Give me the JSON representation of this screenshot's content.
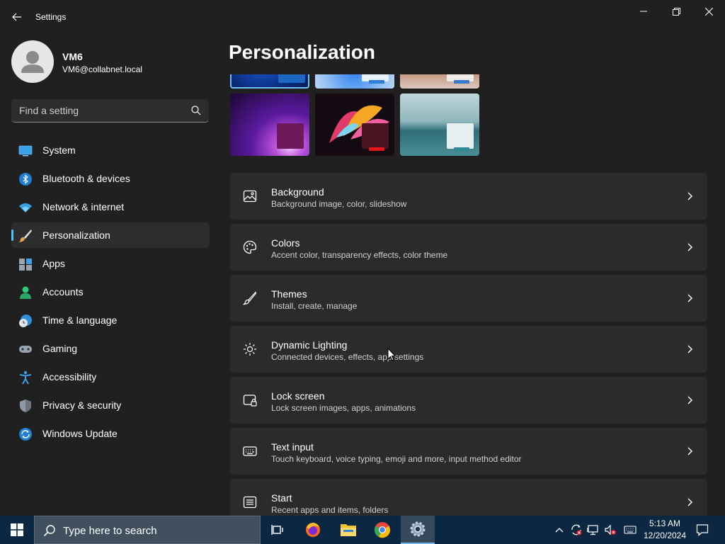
{
  "window": {
    "title": "Settings",
    "back_icon": "back-arrow-icon",
    "controls": [
      "minimize-icon",
      "maximize-icon",
      "close-icon"
    ]
  },
  "profile": {
    "name": "VM6",
    "email": "VM6@collabnet.local"
  },
  "search": {
    "placeholder": "Find a setting",
    "icon": "search-icon"
  },
  "sidebar": {
    "items": [
      {
        "label": "System",
        "icon": "system-icon",
        "active": false
      },
      {
        "label": "Bluetooth & devices",
        "icon": "bluetooth-icon",
        "active": false
      },
      {
        "label": "Network & internet",
        "icon": "wifi-icon",
        "active": false
      },
      {
        "label": "Personalization",
        "icon": "brush-icon",
        "active": true
      },
      {
        "label": "Apps",
        "icon": "apps-icon",
        "active": false
      },
      {
        "label": "Accounts",
        "icon": "accounts-icon",
        "active": false
      },
      {
        "label": "Time & language",
        "icon": "time-language-icon",
        "active": false
      },
      {
        "label": "Gaming",
        "icon": "gamepad-icon",
        "active": false
      },
      {
        "label": "Accessibility",
        "icon": "accessibility-icon",
        "active": false
      },
      {
        "label": "Privacy & security",
        "icon": "shield-icon",
        "active": false
      },
      {
        "label": "Windows Update",
        "icon": "update-icon",
        "active": false
      }
    ]
  },
  "main": {
    "title": "Personalization",
    "themes": [
      {
        "name": "theme-windows-light-blue",
        "selected": true
      },
      {
        "name": "theme-windows-bloom-light",
        "selected": false
      },
      {
        "name": "theme-desert",
        "selected": false
      },
      {
        "name": "theme-glow-purple",
        "selected": false
      },
      {
        "name": "theme-captured-motion",
        "selected": false
      },
      {
        "name": "theme-flow-lake",
        "selected": false
      }
    ],
    "cards": [
      {
        "title": "Background",
        "subtitle": "Background image, color, slideshow",
        "icon": "image-icon"
      },
      {
        "title": "Colors",
        "subtitle": "Accent color, transparency effects, color theme",
        "icon": "palette-icon"
      },
      {
        "title": "Themes",
        "subtitle": "Install, create, manage",
        "icon": "brush-icon"
      },
      {
        "title": "Dynamic Lighting",
        "subtitle": "Connected devices, effects, app settings",
        "icon": "lighting-icon"
      },
      {
        "title": "Lock screen",
        "subtitle": "Lock screen images, apps, animations",
        "icon": "lock-screen-icon"
      },
      {
        "title": "Text input",
        "subtitle": "Touch keyboard, voice typing, emoji and more, input method editor",
        "icon": "keyboard-icon"
      },
      {
        "title": "Start",
        "subtitle": "Recent apps and items, folders",
        "icon": "start-icon"
      }
    ]
  },
  "taskbar": {
    "search_placeholder": "Type here to search",
    "apps": [
      "task-view-icon",
      "firefox-icon",
      "file-explorer-icon",
      "chrome-icon",
      "settings-app-icon"
    ],
    "tray": [
      "chevron-up-icon",
      "sync-icon",
      "network-icon",
      "volume-muted-icon",
      "keyboard-icon"
    ],
    "time": "5:13 AM",
    "date": "12/20/2024",
    "notification_icon": "notification-icon"
  },
  "colors": {
    "accent": "#4cc2ff",
    "background": "#202020",
    "card": "#2b2b2b",
    "taskbar": "#0c2741"
  }
}
